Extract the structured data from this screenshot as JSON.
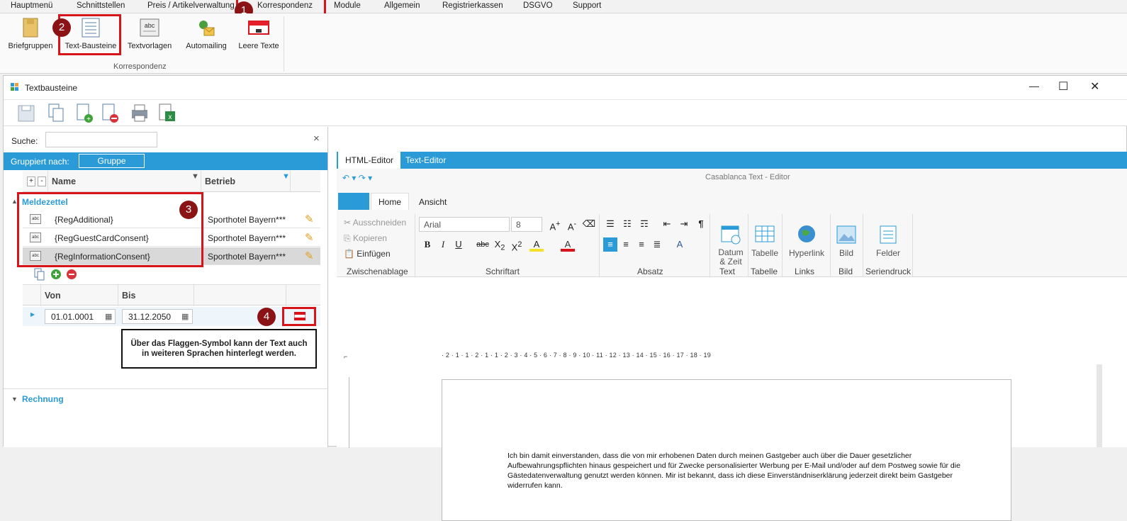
{
  "menu": {
    "tabs": [
      "Hauptmenü",
      "Schnittstellen",
      "Preis / Artikelverwaltung",
      "Korrespondenz",
      "Module",
      "Allgemein",
      "Registrierkassen",
      "DSGVO",
      "Support"
    ]
  },
  "ribbon": {
    "buttons": [
      "Briefgruppen",
      "Text-Bausteine",
      "Textvorlagen",
      "Automailing",
      "Leere Texte"
    ],
    "group": "Korrespondenz"
  },
  "badges": [
    "1",
    "2",
    "3",
    "4"
  ],
  "window": {
    "title": "Textbausteine",
    "minimize": "—",
    "maximize": "☐",
    "close": "✕"
  },
  "search": {
    "label": "Suche:",
    "value": "",
    "clear": "×"
  },
  "grouping": {
    "label": "Gruppiert nach:",
    "chip": "Gruppe"
  },
  "grid": {
    "headers": {
      "plus": "+",
      "minus": "-",
      "name": "Name",
      "betrieb": "Betrieb"
    },
    "group1": "Meldezettel",
    "rows": [
      {
        "name": "{RegAdditional}",
        "betrieb": "Sporthotel Bayern***"
      },
      {
        "name": "{RegGuestCardConsent}",
        "betrieb": "Sporthotel Bayern***"
      },
      {
        "name": "{RegInformationConsent}",
        "betrieb": "Sporthotel Bayern***"
      }
    ],
    "group2": "Rechnung"
  },
  "subgrid": {
    "von": "Von",
    "bis": "Bis",
    "from_value": "01.01.0001",
    "to_value": "31.12.2050"
  },
  "callout": "Über das Flaggen-Symbol kann der Text auch in weiteren Sprachen hinterlegt werden.",
  "editor": {
    "tabs": [
      "HTML-Editor",
      "Text-Editor"
    ],
    "title": "Casablanca Text - Editor",
    "ribbon_tabs": [
      "Home",
      "Ansicht"
    ],
    "clipboard": [
      "Ausschneiden",
      "Kopieren",
      "Einfügen"
    ],
    "font": "Arial",
    "size": "8",
    "groups": [
      "Zwischenablage",
      "Schriftart",
      "Absatz",
      "Text",
      "Tabelle",
      "Links",
      "Bild",
      "Seriendruck"
    ],
    "big_buttons": [
      "Datum & Zeit",
      "Tabelle",
      "Hyperlink",
      "Bild",
      "Felder"
    ],
    "ruler": "· 2 · 1 · 1 · 2 · 1 · 1 · 2 · 3 · 4 · 5 · 6 · 7 · 8 · 9 · 10 · 11 · 12 · 13 · 14 · 15 · 16 · 17 · 18 · 19",
    "body": "Ich bin damit einverstanden, dass die von mir erhobenen Daten durch meinen Gastgeber auch über die Dauer gesetzlicher Aufbewahrungspflichten hinaus gespeichert und für Zwecke personalisierter Werbung per E-Mail und/oder auf dem Postweg sowie für die Gästedatenverwaltung genutzt werden können. Mir ist bekannt, dass ich diese Einverständniserklärung jederzeit direkt beim Gastgeber widerrufen kann."
  },
  "colors": {
    "accent": "#2a9bd6",
    "highlight": "#d8141b",
    "badge": "#8b1316"
  }
}
